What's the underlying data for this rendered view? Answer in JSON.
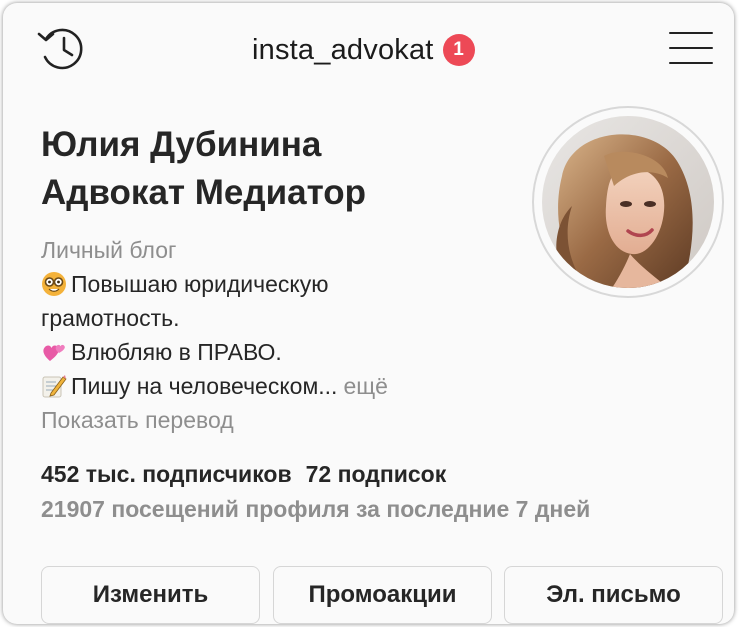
{
  "header": {
    "username": "insta_advokat",
    "notification_count": "1",
    "history_icon": "history-clock-icon",
    "menu_icon": "hamburger-menu-icon"
  },
  "profile": {
    "name_line1": "Юлия Дубинина",
    "name_line2": "Адвокат Медиатор",
    "category": "Личный блог",
    "bio": [
      {
        "emoji": "nerd-face-emoji",
        "text": "Повышаю юридическую"
      },
      {
        "emoji": "",
        "text": "грамотность."
      },
      {
        "emoji": "revolving-hearts-emoji",
        "text": "Влюбляю в ПРАВО."
      },
      {
        "emoji": "memo-pencil-emoji",
        "text": "Пишу на человеческом..."
      }
    ],
    "more_label": "ещё",
    "translate_label": "Показать перевод"
  },
  "stats": {
    "followers": "452 тыс. подписчиков",
    "following": "72 подписок",
    "visits": "21907 посещений профиля за последние 7 дней"
  },
  "buttons": {
    "edit": "Изменить",
    "promo": "Промоакции",
    "email": "Эл. письмо"
  },
  "colors": {
    "background": "#fafafa",
    "badge": "#ed4956",
    "text": "#262626",
    "secondary_text": "#8e8e8e"
  }
}
